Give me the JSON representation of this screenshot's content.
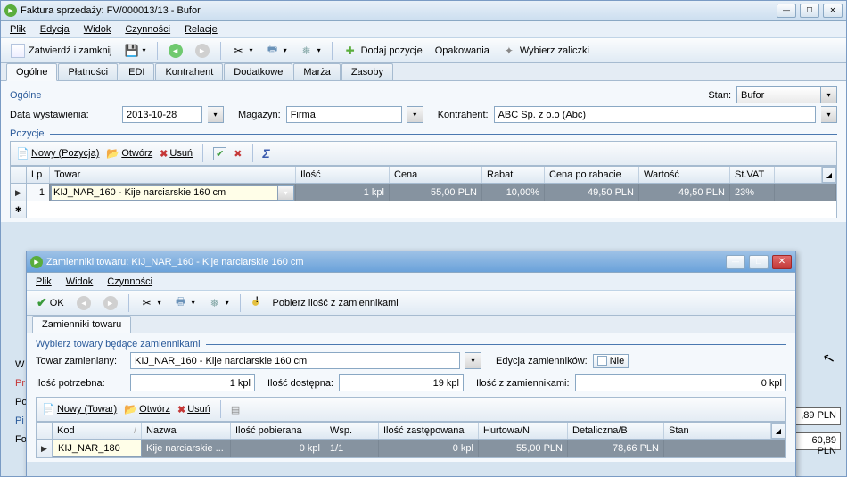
{
  "mainWindow": {
    "title": "Faktura sprzedaży: FV/000013/13 - Bufor",
    "menu": [
      "Plik",
      "Edycja",
      "Widok",
      "Czynności",
      "Relacje"
    ],
    "toolbar": {
      "approveClose": "Zatwierdź i zamknij",
      "addPosition": "Dodaj pozycje",
      "packaging": "Opakowania",
      "selectAdvances": "Wybierz zaliczki"
    },
    "tabs": [
      "Ogólne",
      "Płatności",
      "EDI",
      "Kontrahent",
      "Dodatkowe",
      "Marża",
      "Zasoby"
    ],
    "general": {
      "sectionOgolne": "Ogólne",
      "stanLbl": "Stan:",
      "stanVal": "Bufor",
      "dateLbl": "Data wystawienia:",
      "dateVal": "2013-10-28",
      "warehouseLbl": "Magazyn:",
      "warehouseVal": "Firma",
      "contractorLbl": "Kontrahent:",
      "contractorVal": "ABC Sp. z o.o (Abc)"
    },
    "positions": {
      "section": "Pozycje",
      "newLabel": "Nowy (Pozycja)",
      "openLabel": "Otwórz",
      "deleteLabel": "Usuń",
      "cols": {
        "lp": "Lp",
        "towar": "Towar",
        "ilosc": "Ilość",
        "cena": "Cena",
        "rabat": "Rabat",
        "cenaPoRabacie": "Cena po rabacie",
        "wartosc": "Wartość",
        "stVat": "St.VAT"
      },
      "row": {
        "lp": "1",
        "towar": "KIJ_NAR_160 - Kije narciarskie 160 cm",
        "ilosc": "1 kpl",
        "cena": "55,00 PLN",
        "rabat": "10,00%",
        "cenaPoRabacie": "49,50 PLN",
        "wartosc": "49,50 PLN",
        "stVat": "23%"
      }
    },
    "sideLabels": [
      "W",
      "Pr",
      "Po",
      "Pi",
      "Fo"
    ],
    "sideValues": [
      ",89 PLN",
      "60,89 PLN"
    ]
  },
  "innerWindow": {
    "title": "Zamienniki towaru: KIJ_NAR_160 - Kije narciarskie 160 cm",
    "menu": [
      "Plik",
      "Widok",
      "Czynności"
    ],
    "toolbar": {
      "ok": "OK",
      "pobierz": "Pobierz ilość z zamiennikami"
    },
    "tab": "Zamienniki towaru",
    "group": "Wybierz towary będące zamiennikami",
    "fields": {
      "towarZamLbl": "Towar zamieniany:",
      "towarZamVal": "KIJ_NAR_160 - Kije narciarskie 160 cm",
      "edycjaLbl": "Edycja zamienników:",
      "nieBtn": "Nie",
      "iloscPotLbl": "Ilość potrzebna:",
      "iloscPotVal": "1 kpl",
      "iloscDostLbl": "Ilość dostępna:",
      "iloscDostVal": "19 kpl",
      "iloscZamLbl": "Ilość z zamiennikami:",
      "iloscZamVal": "0 kpl"
    },
    "grid": {
      "newLabel": "Nowy (Towar)",
      "openLabel": "Otwórz",
      "deleteLabel": "Usuń",
      "cols": {
        "kod": "Kod",
        "nazwa": "Nazwa",
        "iloscPob": "Ilość pobierana",
        "wsp": "Wsp.",
        "iloscZast": "Ilość zastępowana",
        "hurtowa": "Hurtowa/N",
        "detal": "Detaliczna/B",
        "stan": "Stan"
      },
      "row": {
        "kod": "KIJ_NAR_180",
        "nazwa": "Kije narciarskie ...",
        "iloscPob": "0 kpl",
        "wsp": "1/1",
        "iloscZast": "0 kpl",
        "hurtowa": "55,00 PLN",
        "detal": "78,66 PLN",
        "stan": ""
      }
    }
  }
}
